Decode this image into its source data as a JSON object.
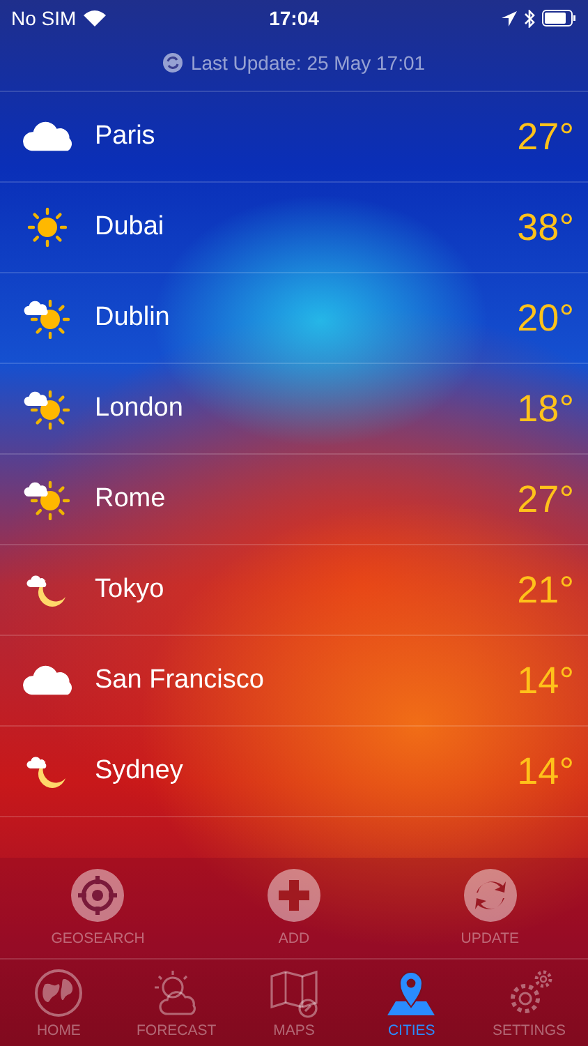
{
  "status_bar": {
    "carrier": "No SIM",
    "time": "17:04"
  },
  "last_update": "Last Update: 25 May 17:01",
  "cities": [
    {
      "name": "Paris",
      "temp": "27°",
      "kind": "cloudy"
    },
    {
      "name": "Dubai",
      "temp": "38°",
      "kind": "sunny"
    },
    {
      "name": "Dublin",
      "temp": "20°",
      "kind": "partly-sunny"
    },
    {
      "name": "London",
      "temp": "18°",
      "kind": "partly-sunny"
    },
    {
      "name": "Rome",
      "temp": "27°",
      "kind": "partly-sunny"
    },
    {
      "name": "Tokyo",
      "temp": "21°",
      "kind": "night-cloud"
    },
    {
      "name": "San Francisco",
      "temp": "14°",
      "kind": "cloudy"
    },
    {
      "name": "Sydney",
      "temp": "14°",
      "kind": "night-cloud"
    }
  ],
  "actions": [
    {
      "label": "GEOSEARCH",
      "kind": "target"
    },
    {
      "label": "ADD",
      "kind": "plus"
    },
    {
      "label": "UPDATE",
      "kind": "refresh"
    }
  ],
  "tabs": [
    {
      "label": "HOME",
      "kind": "globe",
      "selected": false
    },
    {
      "label": "FORECAST",
      "kind": "sun-cloud",
      "selected": false
    },
    {
      "label": "MAPS",
      "kind": "map",
      "selected": false
    },
    {
      "label": "CITIES",
      "kind": "pin",
      "selected": true
    },
    {
      "label": "SETTINGS",
      "kind": "gears",
      "selected": false
    }
  ]
}
